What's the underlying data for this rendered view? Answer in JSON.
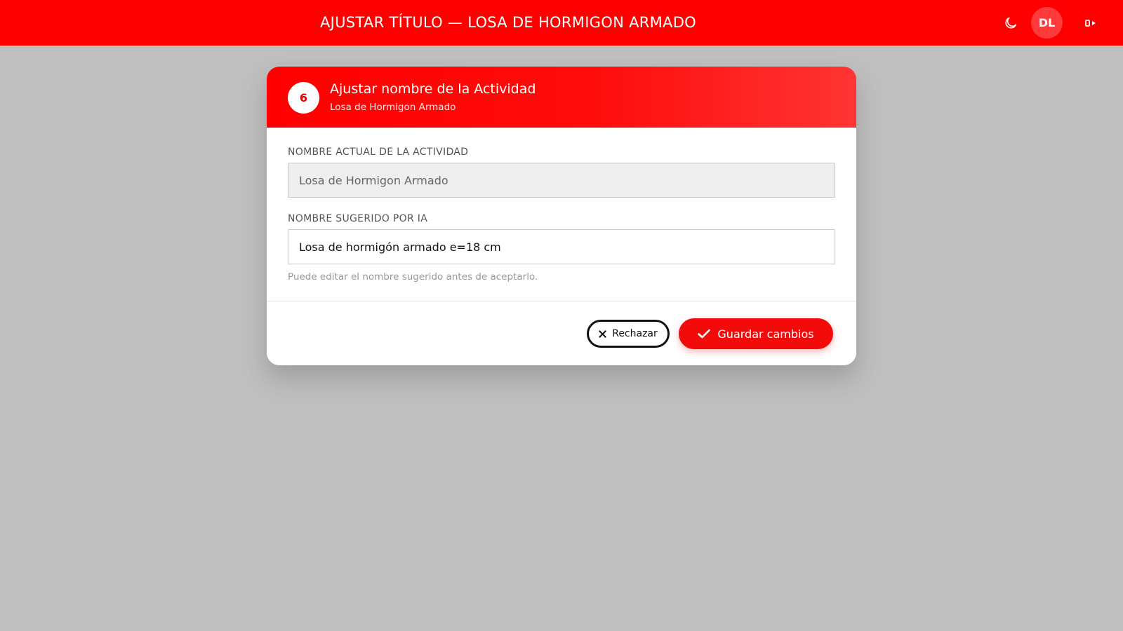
{
  "header": {
    "title": "AJUSTAR TÍTULO — LOSA DE HORMIGON ARMADO",
    "theme_icon": "moon-icon",
    "avatar_initials": "DL",
    "logout_icon": "logout-icon"
  },
  "modal": {
    "step_number": "6",
    "title": "Ajustar nombre de la Actividad",
    "subtitle": "Losa de Hormigon Armado",
    "current_name": {
      "label": "NOMBRE ACTUAL DE LA ACTIVIDAD",
      "value": "Losa de Hormigon Armado"
    },
    "suggested_name": {
      "label": "NOMBRE SUGERIDO POR IA",
      "value": "Losa de hormigón armado e=18 cm",
      "help": "Puede editar el nombre sugerido antes de aceptarlo."
    },
    "actions": {
      "reject_label": "Rechazar",
      "reject_icon": "close-icon",
      "save_label": "Guardar cambios",
      "save_icon": "check-icon"
    }
  },
  "colors": {
    "brand_red": "#ff0000",
    "backdrop": "#bfbfbf",
    "surface": "#ffffff"
  }
}
